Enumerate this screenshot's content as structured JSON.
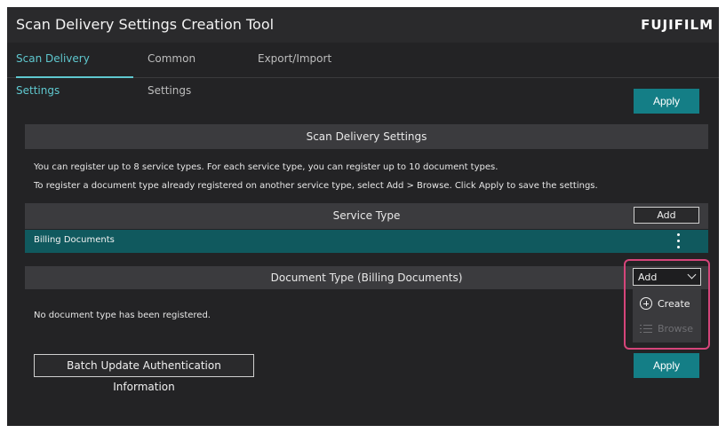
{
  "app": {
    "title": "Scan Delivery Settings Creation Tool",
    "brand": "FUJIFILM"
  },
  "tabs": [
    {
      "label": "Scan Delivery Settings",
      "active": true
    },
    {
      "label": "Common Settings",
      "active": false
    },
    {
      "label": "Export/Import",
      "active": false
    }
  ],
  "top_apply_label": "Apply",
  "scan_section": {
    "title": "Scan Delivery Settings",
    "info_line1": "You can register up to 8 service types. For each service type, you can register up to 10 document types.",
    "info_line2": "To register a document type already registered on another service type, select Add > Browse. Click Apply to save the settings."
  },
  "service_type": {
    "header": "Service Type",
    "add_label": "Add",
    "selected_item": "Billing Documents"
  },
  "document_type": {
    "header": "Document Type (Billing Documents)",
    "add_dropdown_label": "Add",
    "menu": [
      {
        "label": "Create",
        "icon": "plus-circle-icon",
        "enabled": true
      },
      {
        "label": "Browse",
        "icon": "list-icon",
        "enabled": false
      }
    ],
    "empty_message": "No document type has been registered."
  },
  "batch_update_label": "Batch Update Authentication Information",
  "bottom_apply_label": "Apply",
  "colors": {
    "accent": "#147e86",
    "tab_active": "#5fc8cf",
    "highlight": "#d5457a",
    "selected_row": "#10595e"
  }
}
